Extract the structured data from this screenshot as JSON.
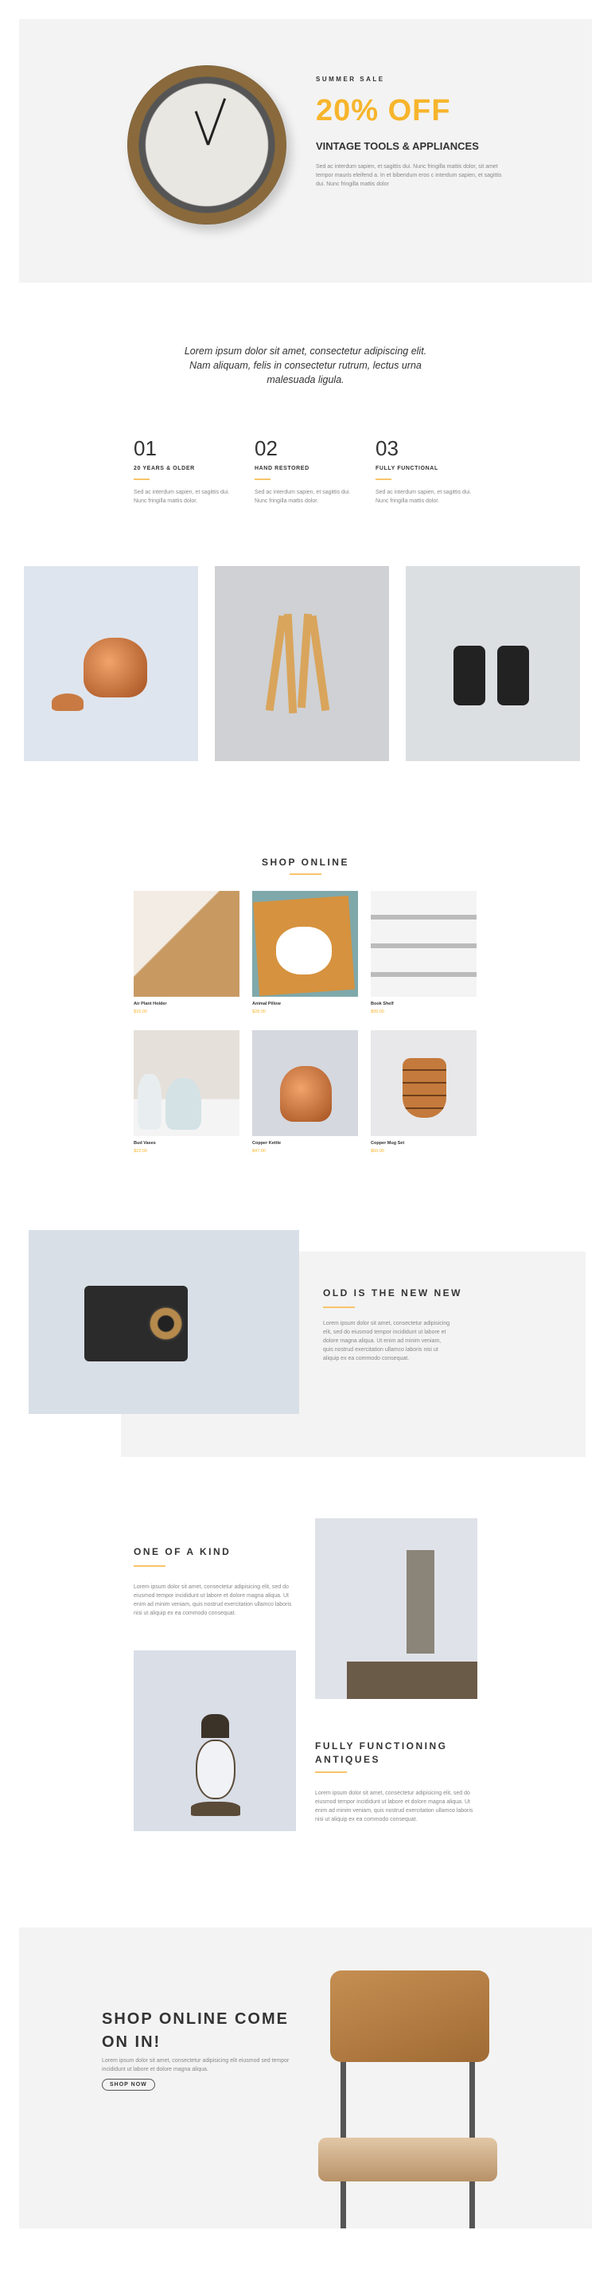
{
  "colors": {
    "accent": "#f7b52c",
    "section_bg": "#f3f3f3",
    "text": "#333333"
  },
  "hero": {
    "eyebrow": "SUMMER SALE",
    "headline": "20% OFF",
    "subtitle": "VINTAGE TOOLS & APPLIANCES",
    "body": "Sed ac interdum sapien, et sagittis dui. Nunc fringilla mattis dolor, sit amet tempor mauris eleifend a. In et bibendum eros c interdum sapien, et sagittis dui. Nunc fringilla mattis dolor",
    "image": "wall-clock"
  },
  "quote": "Lorem ipsum dolor sit amet, consectetur adipiscing elit. Nam aliquam, felis in consectetur rutrum, lectus urna malesuada ligula.",
  "features": [
    {
      "number": "01",
      "title": "20 YEARS & OLDER",
      "text": "Sed ac interdum sapien, et sagittis dui. Nunc fringilla mattis dolor."
    },
    {
      "number": "02",
      "title": "HAND RESTORED",
      "text": "Sed ac interdum sapien, et sagittis dui. Nunc fringilla mattis dolor."
    },
    {
      "number": "03",
      "title": "FULLY FUNCTIONAL",
      "text": "Sed ac interdum sapien, et sagittis dui. Nunc fringilla mattis dolor."
    }
  ],
  "gallery": [
    "copper-kettle",
    "folding-ruler",
    "binoculars"
  ],
  "shop": {
    "title": "SHOP ONLINE",
    "products": [
      {
        "name": "Air Plant Holder",
        "price": "$16.00",
        "image": "air-plant"
      },
      {
        "name": "Animal Pillow",
        "price": "$28.00",
        "image": "pillow"
      },
      {
        "name": "Book Shelf",
        "price": "$99.00",
        "image": "shelf"
      },
      {
        "name": "Bud Vases",
        "price": "$22.00",
        "image": "vases"
      },
      {
        "name": "Copper Kettle",
        "price": "$47.00",
        "image": "kettle"
      },
      {
        "name": "Copper Mug Set",
        "price": "$60.00",
        "image": "mugs"
      }
    ]
  },
  "old_new": {
    "title": "OLD IS THE NEW NEW",
    "body": "Lorem ipsum dolor sit amet, consectetur adipisicing elit, sed do eiusmod tempor incididunt ut labore et dolore magna aliqua. Ut enim ad minim veniam, quis nostrud exercitation ullamco laboris nisi ut aliquip ex ea commodo consequat.",
    "image": "folding-camera"
  },
  "one_kind": {
    "title": "ONE OF A KIND",
    "body": "Lorem ipsum dolor sit amet, consectetur adipisicing elit, sed do eiusmod tempor incididunt ut labore et dolore magna aliqua. Ut enim ad minim veniam, quis nostrud exercitation ullamco laboris nisi ut aliquip ex ea commodo consequat."
  },
  "antiques": {
    "title": "FULLY FUNCTIONING ANTIQUES",
    "body": "Lorem ipsum dolor sit amet, consectetur adipisicing elit, sed do eiusmod tempor incididunt ut labore et dolore magna aliqua. Ut enim ad minim veniam, quis nostrud exercitation ullamco laboris nisi ut aliquip ex ea commodo consequat."
  },
  "cta": {
    "title": "SHOP ONLINE COME ON IN!",
    "body": "Lorem ipsum dolor sit amet, consectetur adipisicing elit eiusmod sed tempor incididunt ut labore et dolore magna aliqua.",
    "button": "SHOP NOW",
    "image": "wooden-stool"
  }
}
